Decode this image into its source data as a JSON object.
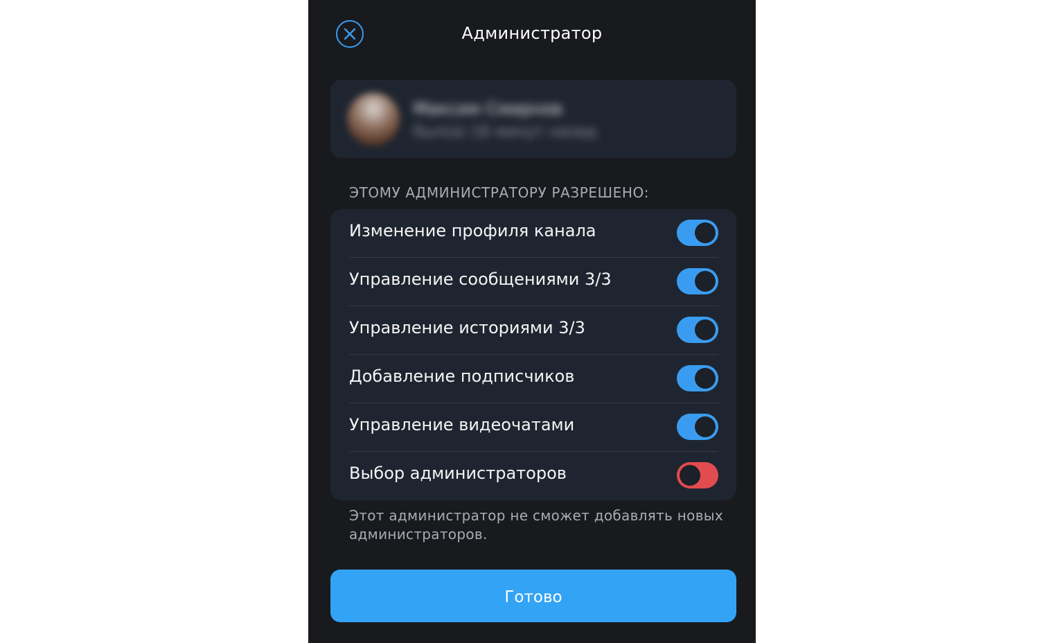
{
  "header": {
    "title": "Администратор",
    "close_icon": "close-circle-icon"
  },
  "user": {
    "name": "Максим Смирнов",
    "status": "был(а) 16 минут назад"
  },
  "permissions": {
    "section_title": "ЭТОМУ АДМИНИСТРАТОРУ РАЗРЕШЕНО:",
    "items": [
      {
        "label": "Изменение профиля канала",
        "enabled": true
      },
      {
        "label": "Управление сообщениями 3/3",
        "enabled": true
      },
      {
        "label": "Управление историями 3/3",
        "enabled": true
      },
      {
        "label": "Добавление подписчиков",
        "enabled": true
      },
      {
        "label": "Управление видеочатами",
        "enabled": true
      },
      {
        "label": "Выбор администраторов",
        "enabled": false
      }
    ],
    "footer_note": "Этот администратор не сможет добавлять новых администраторов."
  },
  "actions": {
    "done_label": "Готово"
  },
  "colors": {
    "background": "#191a1e",
    "card": "#1f2530",
    "accent": "#33a3f5",
    "toggle_on": "#3a9cf0",
    "toggle_off": "#e24b4f"
  }
}
